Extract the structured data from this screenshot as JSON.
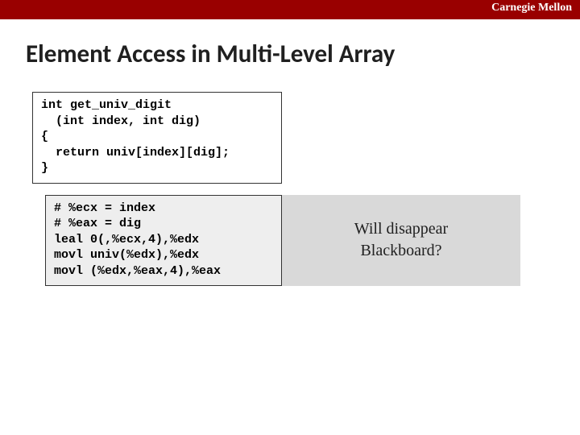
{
  "header": {
    "brand": "Carnegie Mellon"
  },
  "title": "Element Access in Multi-Level Array",
  "c_code": "int get_univ_digit\n  (int index, int dig)\n{\n  return univ[index][dig];\n}",
  "asm_code": "# %ecx = index\n# %eax = dig\nleal 0(,%ecx,4),%edx\nmovl univ(%edx),%edx\nmovl (%edx,%eax,4),%eax",
  "callout": {
    "line1": "Will disappear",
    "line2": "Blackboard?"
  }
}
